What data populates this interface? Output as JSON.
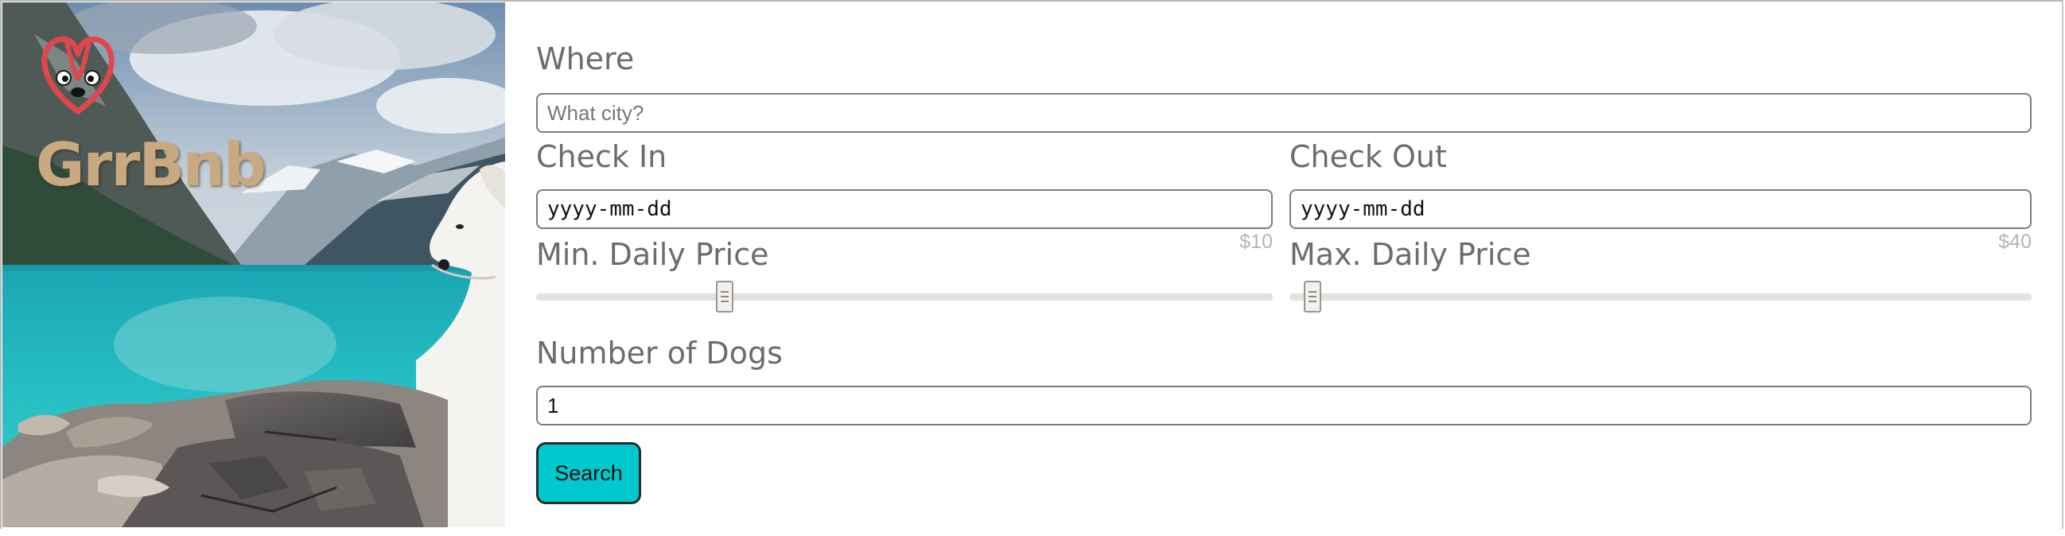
{
  "brand": {
    "name": "GrrBnb"
  },
  "form": {
    "where_label": "Where",
    "where_placeholder": "What city?",
    "check_in_label": "Check In",
    "check_in_value": "yyyy-mm-dd",
    "check_out_label": "Check Out",
    "check_out_value": "yyyy-mm-dd",
    "min_price_label": "Min. Daily Price",
    "min_price_value": "$10",
    "min_price_fraction": 0.25,
    "max_price_label": "Max. Daily Price",
    "max_price_value": "$40",
    "max_price_fraction": 0.02,
    "dogs_label": "Number of Dogs",
    "dogs_value": "1",
    "search_label": "Search"
  },
  "colors": {
    "accent": "#00c8cc",
    "label": "#6c6c6c",
    "brand_text": "#c9aa80",
    "logo_red": "#e0474c"
  },
  "icons": {
    "logo": "dog-heart-logo-icon",
    "slider_thumb": "slider-grip-icon"
  }
}
